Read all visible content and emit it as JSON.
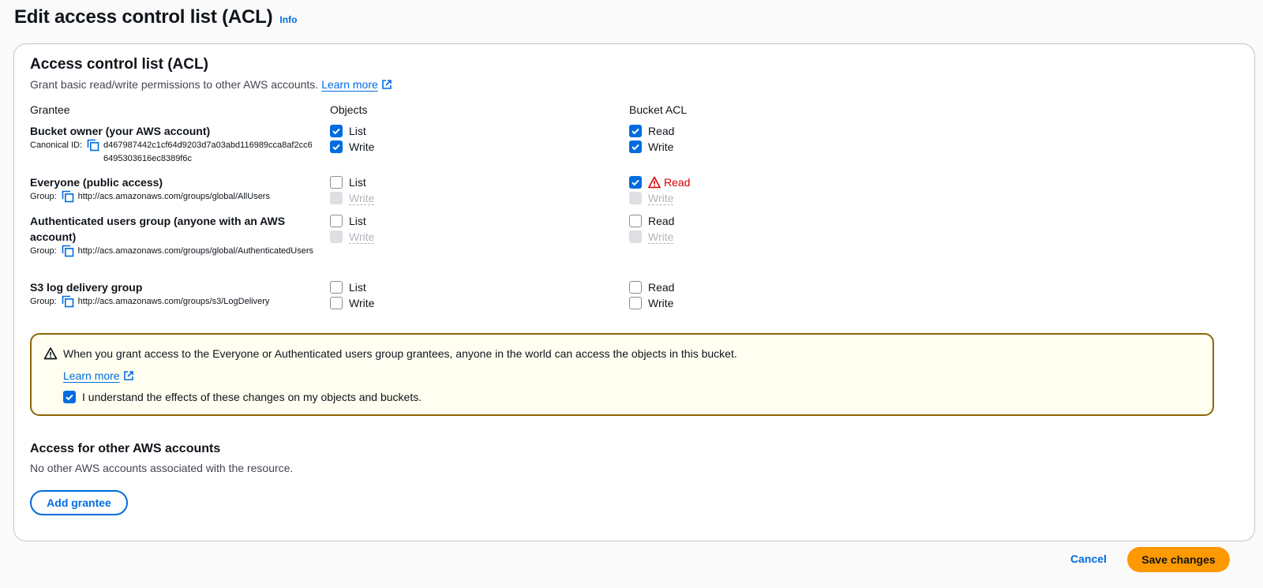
{
  "page": {
    "title": "Edit access control list (ACL)",
    "info_label": "Info"
  },
  "acl": {
    "title": "Access control list (ACL)",
    "description": "Grant basic read/write permissions to other AWS accounts.",
    "learn_more": "Learn more",
    "columns": {
      "grantee": "Grantee",
      "objects": "Objects",
      "bucket_acl": "Bucket ACL"
    },
    "grantees": [
      {
        "name": "Bucket owner (your AWS account)",
        "sub_key": "Canonical ID:",
        "sub_value": "d467987442c1cf64d9203d7a03abd116989cca8af2cc66495303616ec8389f6c",
        "objects": [
          {
            "label": "List",
            "state": "checked"
          },
          {
            "label": "Write",
            "state": "checked"
          }
        ],
        "bucket_acl": [
          {
            "label": "Read",
            "state": "checked"
          },
          {
            "label": "Write",
            "state": "checked"
          }
        ]
      },
      {
        "name": "Everyone (public access)",
        "sub_key": "Group:",
        "sub_value": "http://acs.amazonaws.com/groups/global/AllUsers",
        "objects": [
          {
            "label": "List",
            "state": "unchecked"
          },
          {
            "label": "Write",
            "state": "disabled"
          }
        ],
        "bucket_acl": [
          {
            "label": "Read",
            "state": "checked",
            "warning": true
          },
          {
            "label": "Write",
            "state": "disabled"
          }
        ]
      },
      {
        "name": "Authenticated users group (anyone with an AWS account)",
        "sub_key": "Group:",
        "sub_value": "http://acs.amazonaws.com/groups/global/AuthenticatedUsers",
        "objects": [
          {
            "label": "List",
            "state": "unchecked"
          },
          {
            "label": "Write",
            "state": "disabled"
          }
        ],
        "bucket_acl": [
          {
            "label": "Read",
            "state": "unchecked"
          },
          {
            "label": "Write",
            "state": "disabled"
          }
        ]
      },
      {
        "name": "S3 log delivery group",
        "sub_key": "Group:",
        "sub_value": "http://acs.amazonaws.com/groups/s3/LogDelivery",
        "objects": [
          {
            "label": "List",
            "state": "unchecked"
          },
          {
            "label": "Write",
            "state": "unchecked"
          }
        ],
        "bucket_acl": [
          {
            "label": "Read",
            "state": "unchecked"
          },
          {
            "label": "Write",
            "state": "unchecked"
          }
        ]
      }
    ]
  },
  "alert": {
    "text": "When you grant access to the Everyone or Authenticated users group grantees, anyone in the world can access the objects in this bucket.",
    "learn_more": "Learn more",
    "ack_label": "I understand the effects of these changes on my objects and buckets.",
    "ack_checked": true
  },
  "other_accounts": {
    "title": "Access for other AWS accounts",
    "description": "No other AWS accounts associated with the resource.",
    "add_button": "Add grantee"
  },
  "footer": {
    "cancel": "Cancel",
    "save": "Save changes"
  },
  "colors": {
    "accent": "#006ce0",
    "primary_button": "#ff9900",
    "warning_border": "#8d6605",
    "danger": "#db0000"
  },
  "icons": {
    "external_link": "external-link-icon",
    "copy": "copy-icon",
    "warning": "warning-icon",
    "checkbox": "check-icon"
  }
}
